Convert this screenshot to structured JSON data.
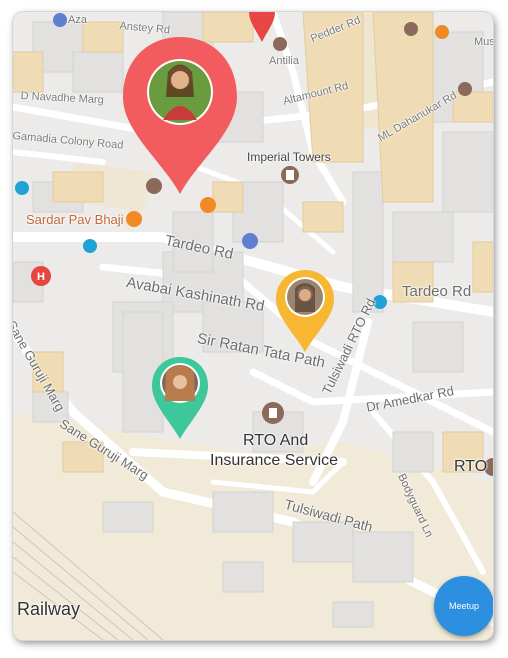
{
  "map": {
    "roads": {
      "azad": "Aza",
      "anstey": "Anstey Rd",
      "pedder": "Pedder Rd",
      "antilia": "Antilia",
      "muse": "Muse",
      "altamount": "Altamount Rd",
      "d_marg": "D Navadhe Marg",
      "ml_dahanukar": "ML Dahanukar Rd",
      "gamadia": "Gamadia Colony Road",
      "imperial": "Imperial Towers",
      "sardar": "Sardar Pav Bhaji",
      "tardeo": "Tardeo Rd",
      "tardeo2": "Tardeo Rd",
      "avabai": "Avabai Kashinath Rd",
      "ratan": "Sir Ratan Tata Path",
      "tulsiwadi_rto": "Tulsiwadi RTO Rd",
      "sane_guruji": "Sane Guruji Marg",
      "sane_guruji2": "Sane Guruji Marg",
      "ambedkar": "Dr Amedkar Rd",
      "bodyguard": "Bodyguard Ln",
      "tulsiwadi_path": "Tulsiwadi Path",
      "railway": "Railway"
    },
    "places": {
      "rto_line1": "RTO And",
      "rto_line2": "Insurance Service",
      "rto_right": "RTO"
    },
    "pins": [
      {
        "name": "pin-main-red",
        "color": "#f25c5f"
      },
      {
        "name": "pin-yellow",
        "color": "#f7b733"
      },
      {
        "name": "pin-green",
        "color": "#3dc79a"
      }
    ]
  },
  "fab": {
    "label": "Meetup",
    "color": "#2d8fe0"
  }
}
